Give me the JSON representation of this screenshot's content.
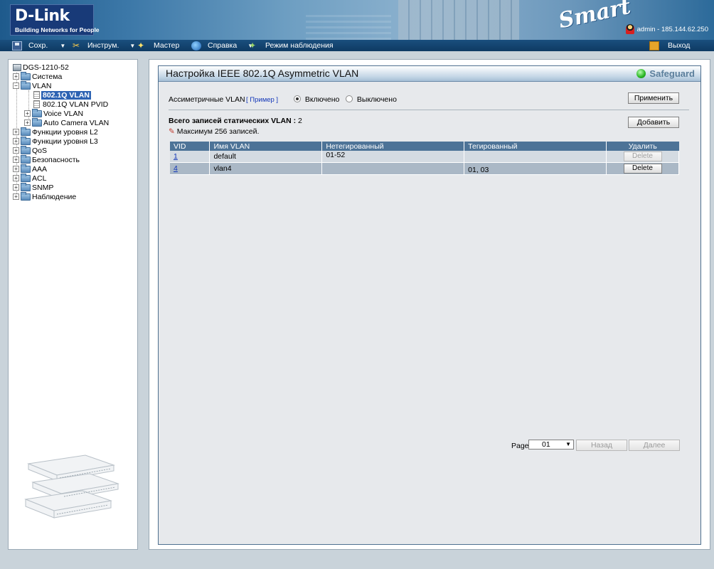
{
  "header": {
    "logo": "D-Link",
    "logo_sub": "Building Networks for People",
    "smart": "Smart",
    "user": "admin - 185.144.62.250"
  },
  "toolbar": {
    "save": "Сохр.",
    "tools": "Инструм.",
    "wizard": "Мастер",
    "help": "Справка",
    "monitor": "Режим наблюдения",
    "logout": "Выход"
  },
  "tree": {
    "root": "DGS-1210-52",
    "items": [
      "Система",
      "VLAN",
      "802.1Q VLAN",
      "802.1Q VLAN PVID",
      "Voice VLAN",
      "Auto Camera VLAN",
      "Функции уровня L2",
      "Функции уровня L3",
      "QoS",
      "Безопасность",
      "AAA",
      "ACL",
      "SNMP",
      "Наблюдение"
    ]
  },
  "main": {
    "title": "Настройка IEEE 802.1Q Asymmetric VLAN",
    "safeguard": "Safeguard",
    "asym_label": "Ассиметричные VLAN",
    "example_link": "[ Пример ]",
    "radio_on": "Включено",
    "radio_off": "Выключено",
    "apply": "Применить",
    "total_label": "Всего записей статических VLAN :",
    "total_value": "2",
    "add": "Добавить",
    "max_note": "Максимум 256 записей.",
    "table": {
      "headers": [
        "VID",
        "Имя VLAN",
        "Нетегированный",
        "Тегированный",
        "Удалить"
      ],
      "rows": [
        {
          "vid": "1",
          "name": "default",
          "untagged": "01-52",
          "tagged": "",
          "delete": "Delete"
        },
        {
          "vid": "4",
          "name": "vlan4",
          "untagged": "",
          "tagged": "01, 03",
          "delete": "Delete"
        }
      ]
    },
    "pager": {
      "page_label": "Page",
      "page_value": "01",
      "prev": "Назад",
      "next": "Далее"
    }
  }
}
